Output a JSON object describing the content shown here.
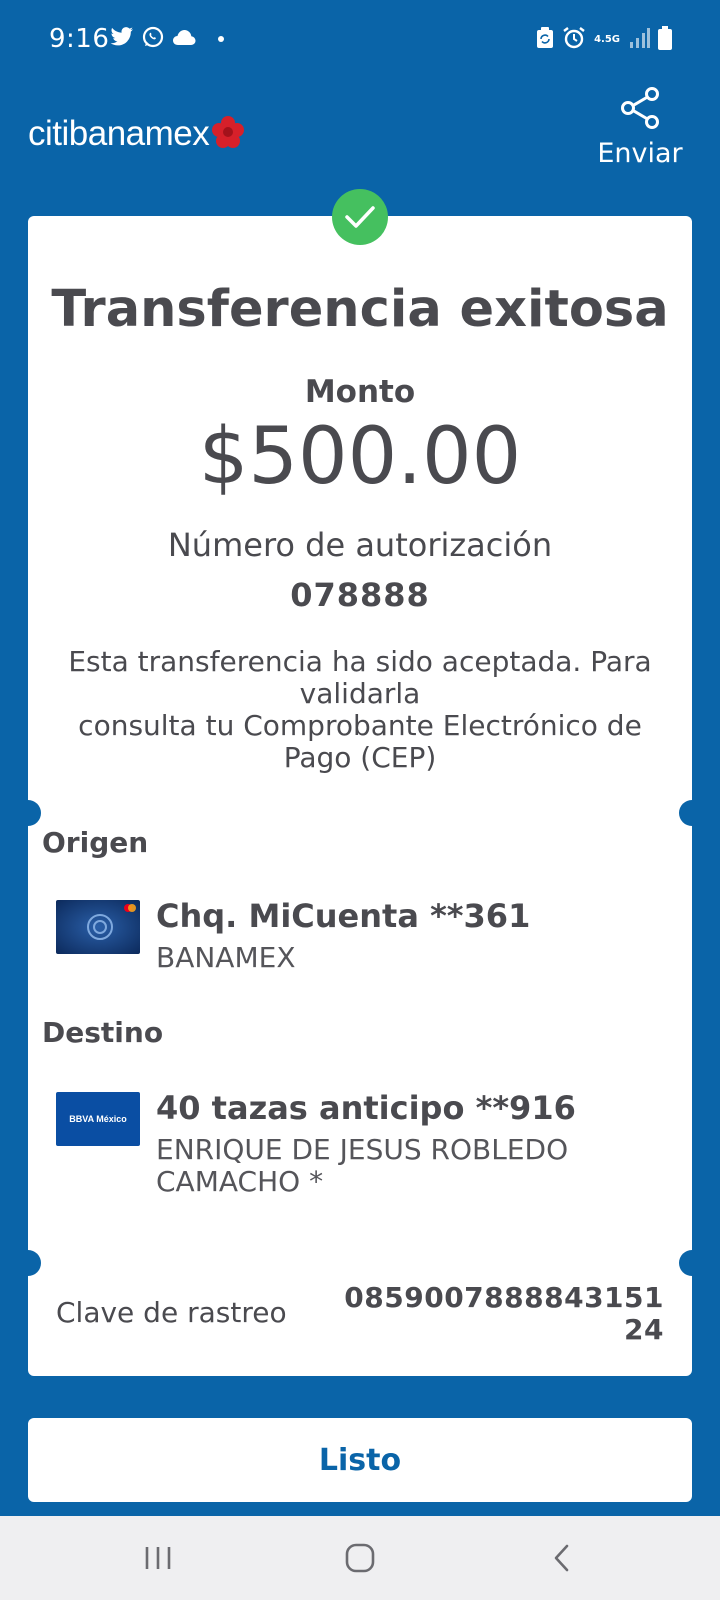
{
  "status_bar": {
    "time": "9:16",
    "network": "4.5G",
    "icons": [
      "twitter-icon",
      "whatsapp-icon",
      "cloud-icon",
      "sync-icon",
      "alarm-icon",
      "signal-icon",
      "battery-icon"
    ]
  },
  "header": {
    "logo_text": "citibanamex",
    "share_label": "Enviar"
  },
  "receipt": {
    "title": "Transferencia exitosa",
    "amount_label": "Monto",
    "amount": "$500.00",
    "auth_label": "Número de autorización",
    "auth_number": "078888",
    "info_text": "Esta transferencia ha sido aceptada. Para validarla\nconsulta tu Comprobante Electrónico de Pago (CEP)",
    "origin": {
      "label": "Origen",
      "account_name": "Chq. MiCuenta **361",
      "bank": "BANAMEX"
    },
    "destination": {
      "label": "Destino",
      "account_name": "40 tazas anticipo **916",
      "holder": "ENRIQUE DE JESUS ROBLEDO CAMACHO *",
      "bank_logo_text": "BBVA México"
    },
    "tracking": {
      "label": "Clave de rastreo",
      "value": "085900788884315124"
    }
  },
  "actions": {
    "done_label": "Listo"
  },
  "colors": {
    "brand_blue": "#0a64a8",
    "success_green": "#45c05f",
    "text_gray": "#4a4a4f"
  }
}
